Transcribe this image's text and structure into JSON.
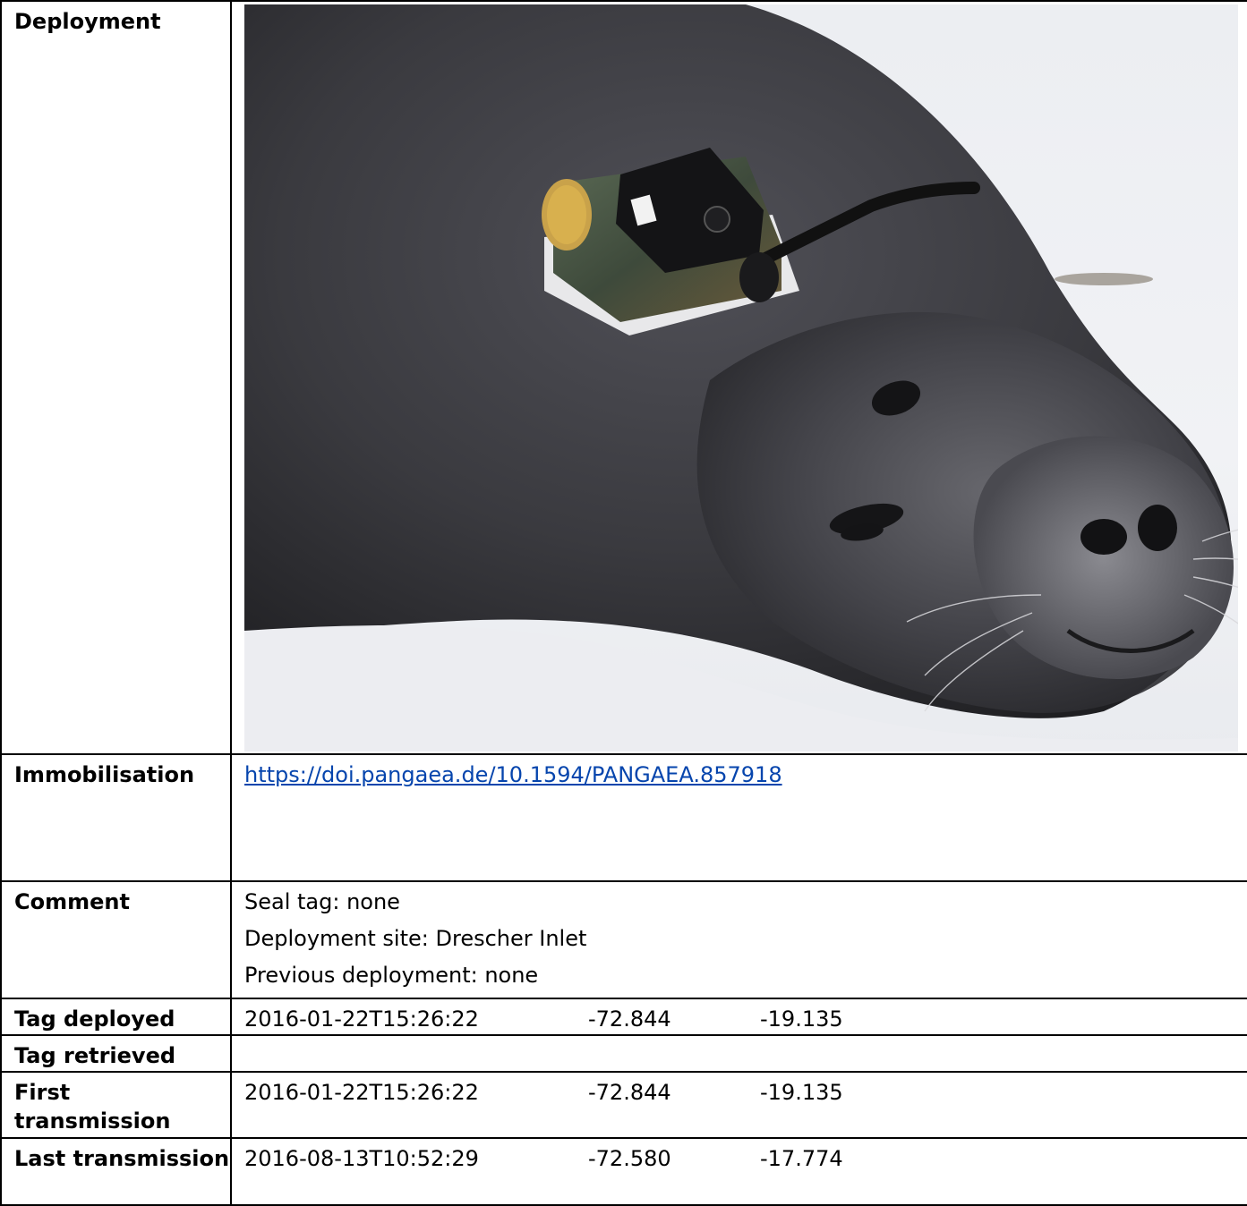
{
  "rows": {
    "deployment": {
      "label": "Deployment"
    },
    "immobilisation": {
      "label": "Immobilisation",
      "link": "https://doi.pangaea.de/10.1594/PANGAEA.857918"
    },
    "comment": {
      "label": "Comment",
      "lines": [
        "Seal tag: none",
        "Deployment site: Drescher Inlet",
        "Previous deployment: none"
      ]
    },
    "tag_deployed": {
      "label": "Tag deployed",
      "time": "2016-01-22T15:26:22",
      "lat": "-72.844",
      "lon": "-19.135"
    },
    "tag_retrieved": {
      "label": "Tag retrieved"
    },
    "first_transmission": {
      "label": "First transmission",
      "time": "2016-01-22T15:26:22",
      "lat": "-72.844",
      "lon": "-19.135"
    },
    "last_transmission": {
      "label": "Last transmission",
      "time": "2016-08-13T10:52:29",
      "lat": "-72.580",
      "lon": "-17.774"
    }
  },
  "colors": {
    "link": "#0645ad",
    "border": "#000000",
    "snow": "#f1f2f5",
    "seal": "#3a3a3e"
  }
}
